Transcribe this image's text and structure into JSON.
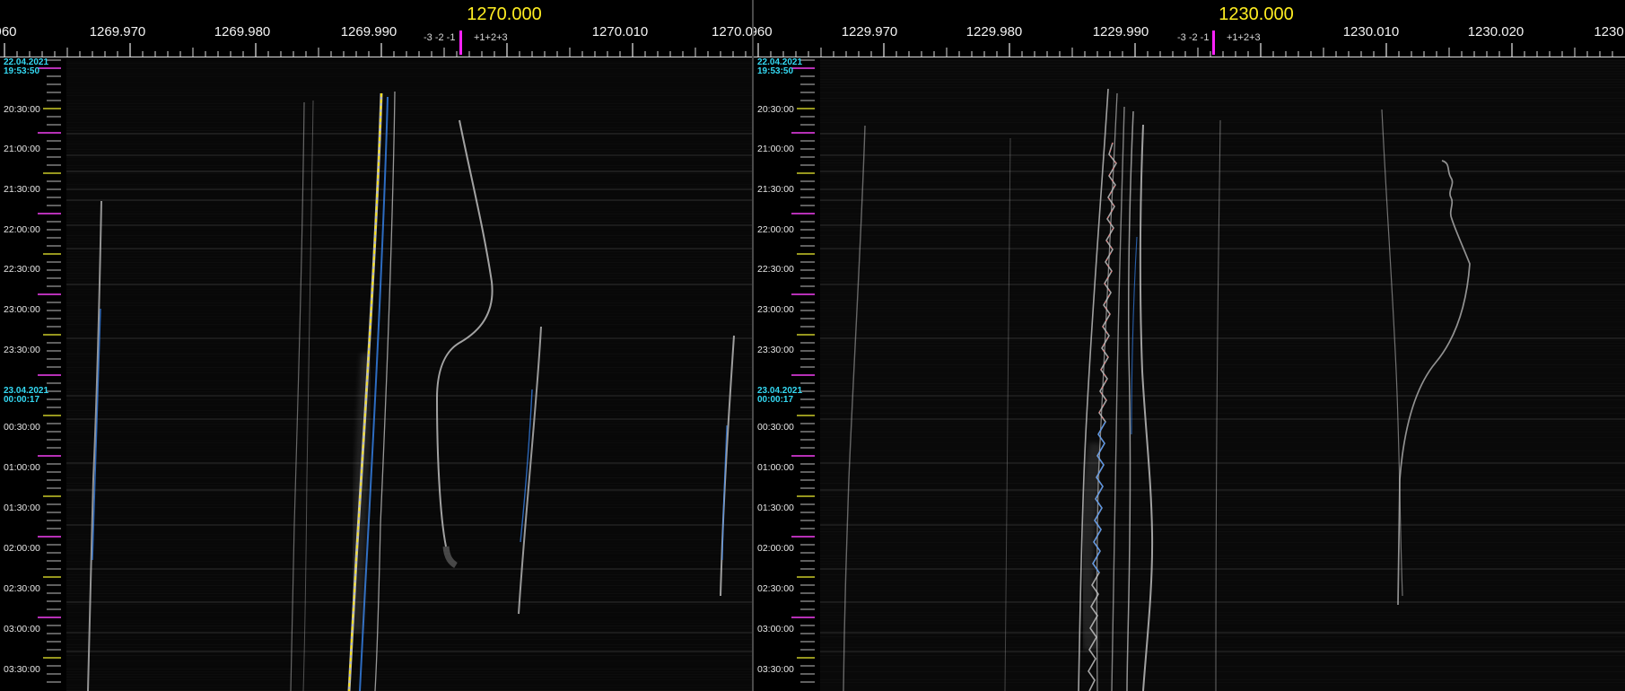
{
  "left_panel": {
    "center_frequency": "1270.000",
    "freq_labels": [
      "960",
      "1269.970",
      "1269.980",
      "1269.990",
      "1270.010",
      "1270.0"
    ],
    "offset_negative": "-3 -2 -1",
    "offset_positive": "+1+2+3",
    "date_start": "22.04.2021",
    "time_start": "19:53:50",
    "date_second": "23.04.2021",
    "time_second": "00:00:17",
    "time_labels": [
      "20:30:00",
      "21:00:00",
      "21:30:00",
      "22:00:00",
      "22:30:00",
      "23:00:00",
      "23:30:00",
      "00:30:00",
      "01:00:00",
      "01:30:00",
      "02:00:00",
      "02:30:00",
      "03:00:00",
      "03:30:00"
    ]
  },
  "right_panel": {
    "center_frequency": "1230.000",
    "freq_labels": [
      ".960",
      "1229.970",
      "1229.980",
      "1229.990",
      "1230.010",
      "1230.020",
      "1230"
    ],
    "offset_negative": "-3 -2 -1",
    "offset_positive": "+1+2+3",
    "date_start": "22.04.2021",
    "time_start": "19:53:50",
    "date_second": "23.04.2021",
    "time_second": "00:00:17",
    "time_labels": [
      "20:30:00",
      "21:00:00",
      "21:30:00",
      "22:00:00",
      "22:30:00",
      "23:00:00",
      "23:30:00",
      "00:30:00",
      "01:00:00",
      "01:30:00",
      "02:00:00",
      "02:30:00",
      "03:00:00",
      "03:30:00"
    ]
  },
  "colors": {
    "center_frequency": "#ffee22",
    "marker": "#ff22ff",
    "date_text": "#34d9f3",
    "hour_tick": "#ff44ff",
    "half_hour_tick": "#ffff33",
    "trace": "#bdbdbd",
    "trace_blue": "#3a8dff",
    "trace_yellow": "#ffe600"
  }
}
